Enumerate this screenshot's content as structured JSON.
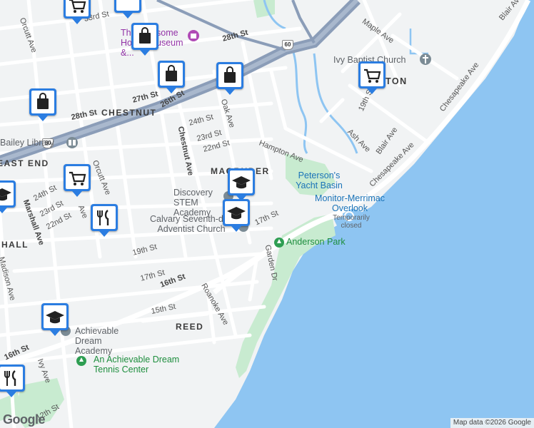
{
  "map": {
    "attribution": "Map data ©2026 Google",
    "logo": "Google",
    "colors": {
      "water": "#8ec5f2",
      "park": "#c8ebd0",
      "land": "#f1f3f4",
      "highway": "#8b9db8",
      "road": "#ffffff",
      "marker": "#2b7de1"
    }
  },
  "neighborhoods": [
    "CHESTNUT",
    "MAGRUDER",
    "REED",
    "HALL",
    "EAST END"
  ],
  "streets": [
    "Orcutt Ave",
    "33rd St",
    "28th St",
    "27th St",
    "26th St",
    "28th St",
    "24th St",
    "23rd St",
    "22nd St",
    "Oak Ave",
    "Chestnut Ave",
    "Hampton Ave",
    "Maple Ave",
    "Blair Ave",
    "19th St",
    "Ash Ave",
    "Blair Ave",
    "Chesapeake Ave",
    "Chesapeake Ave",
    "24th St",
    "23rd St",
    "22nd St",
    "Orcutt Ave",
    "Marshall Ave",
    "17th St",
    "19th St",
    "17th St",
    "16th St",
    "15th St",
    "Roanoke Ave",
    "Garden Dr",
    "Madison Ave",
    "Ivy Ave",
    "16th St",
    "12th St",
    "Ave"
  ],
  "places": {
    "museum": "The Newsome House Museum &...",
    "library": "Bailey Library",
    "church_ivy": "Ivy Baptist Church",
    "yacht": "Peterson's Yacht Basin",
    "overlook": "Monitor-Merrimac Overlook",
    "overlook_status": "Temporarily closed",
    "park": "Anderson Park",
    "discovery": "Discovery STEM Academy",
    "calvary": "Calvary Seventh-day Adventist Church",
    "achievable_academy": "Achievable Dream Academy",
    "tennis": "An Achievable Dream Tennis Center",
    "ton": "TON"
  },
  "highway_shields": [
    "60",
    "60"
  ],
  "markers": [
    {
      "type": "shopping-bag"
    },
    {
      "type": "shopping-bag"
    },
    {
      "type": "shopping-bag"
    },
    {
      "type": "shopping-bag"
    },
    {
      "type": "shopping-cart"
    },
    {
      "type": "shopping-cart"
    },
    {
      "type": "shopping-cart"
    },
    {
      "type": "school"
    },
    {
      "type": "school"
    },
    {
      "type": "school"
    },
    {
      "type": "school"
    },
    {
      "type": "restaurant"
    },
    {
      "type": "restaurant"
    }
  ]
}
